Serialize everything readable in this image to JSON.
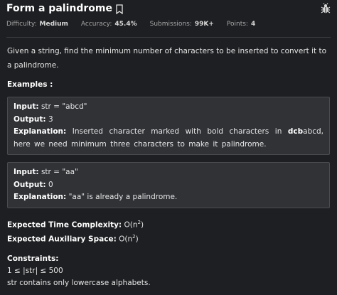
{
  "header": {
    "title": "Form a palindrome",
    "meta": [
      {
        "label": "Difficulty:",
        "value": "Medium"
      },
      {
        "label": "Accuracy:",
        "value": "45.4%"
      },
      {
        "label": "Submissions:",
        "value": "99K+"
      },
      {
        "label": "Points:",
        "value": "4"
      }
    ]
  },
  "problem": {
    "statement": "Given a string, find the minimum number of characters to be inserted to convert it to a palindrome.",
    "examples_label": "Examples :",
    "examples": [
      {
        "input_label": "Input:",
        "input": "str = \"abcd\"",
        "output_label": "Output:",
        "output": "3",
        "explanation_label": "Explanation:",
        "explanation_pre": "Inserted character marked with bold characters in",
        "explanation_bold": "dcb",
        "explanation_post": "abcd, here we need minimum three characters to make it palindrome."
      },
      {
        "input_label": "Input:",
        "input": "str = \"aa\"",
        "output_label": "Output:",
        "output": "0",
        "explanation_label": "Explanation:",
        "explanation": "\"aa\" is already a palindrome."
      }
    ],
    "time_label": "Expected Time Complexity:",
    "time_value": "O(n",
    "time_sup": "2",
    "time_close": ")",
    "space_label": "Expected Auxiliary Space:",
    "space_value": "O(n",
    "space_sup": "2",
    "space_close": ")",
    "constraints_label": "Constraints:",
    "constraints": [
      "1 ≤ |str| ≤ 500",
      "str contains only lowercase alphabets."
    ]
  }
}
